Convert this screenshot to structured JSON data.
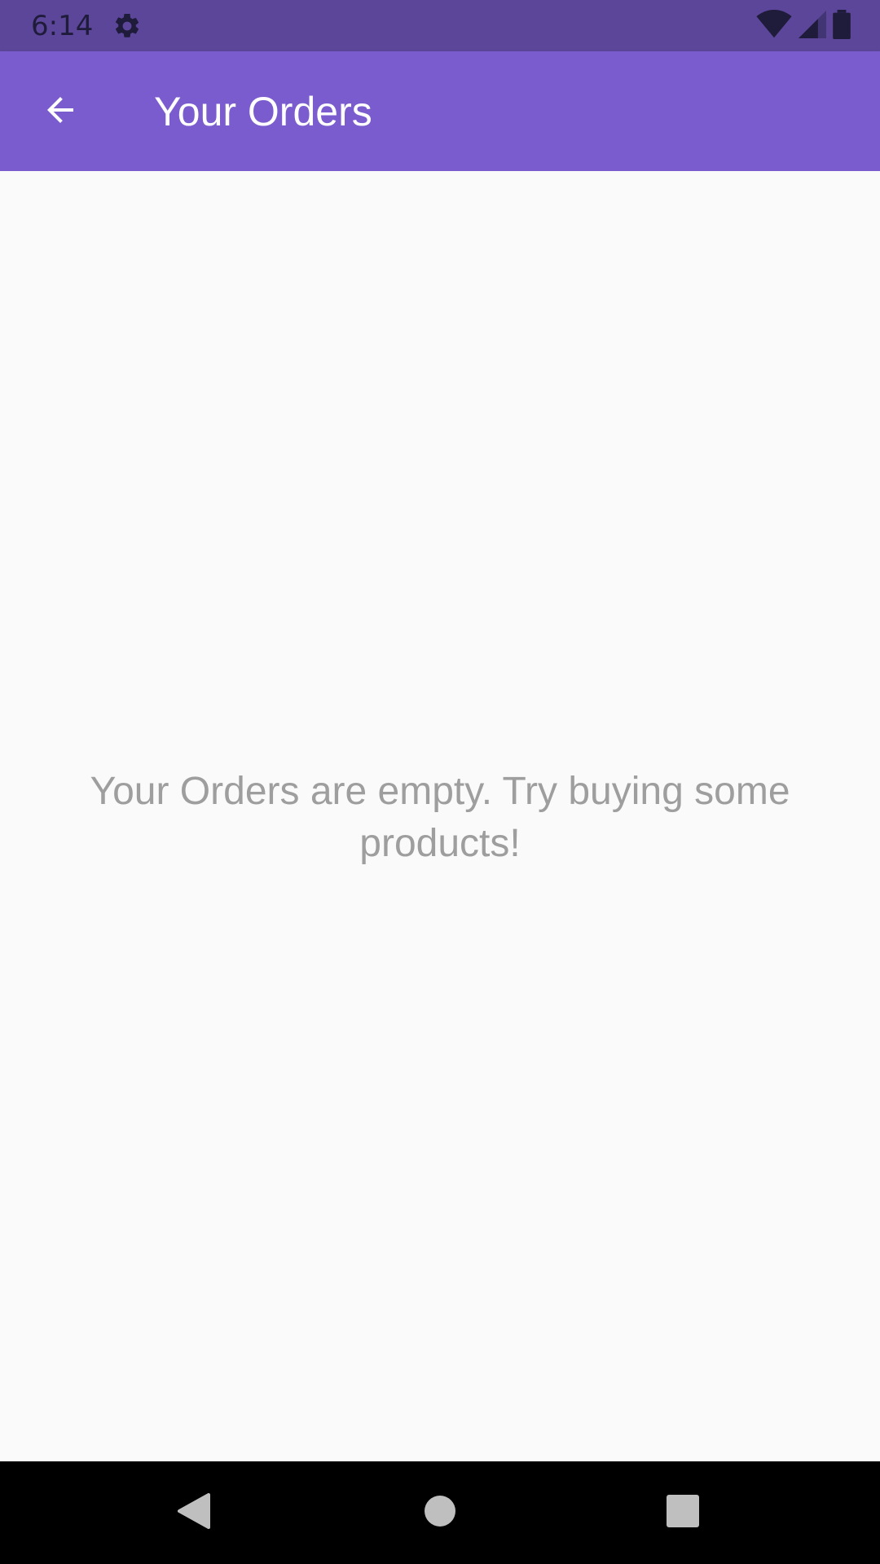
{
  "status_bar": {
    "time": "6:14",
    "icons": [
      "gear-icon",
      "wifi-icon",
      "cellular-signal-icon",
      "battery-icon"
    ],
    "background": "#5b4699"
  },
  "app_bar": {
    "title": "Your Orders",
    "back_icon": "arrow-back-icon",
    "background": "#7a5ccf"
  },
  "content": {
    "empty_message": "Your Orders are empty. Try buying some products!"
  },
  "nav_bar": {
    "buttons": [
      "back-triangle-icon",
      "home-circle-icon",
      "recents-square-icon"
    ]
  }
}
